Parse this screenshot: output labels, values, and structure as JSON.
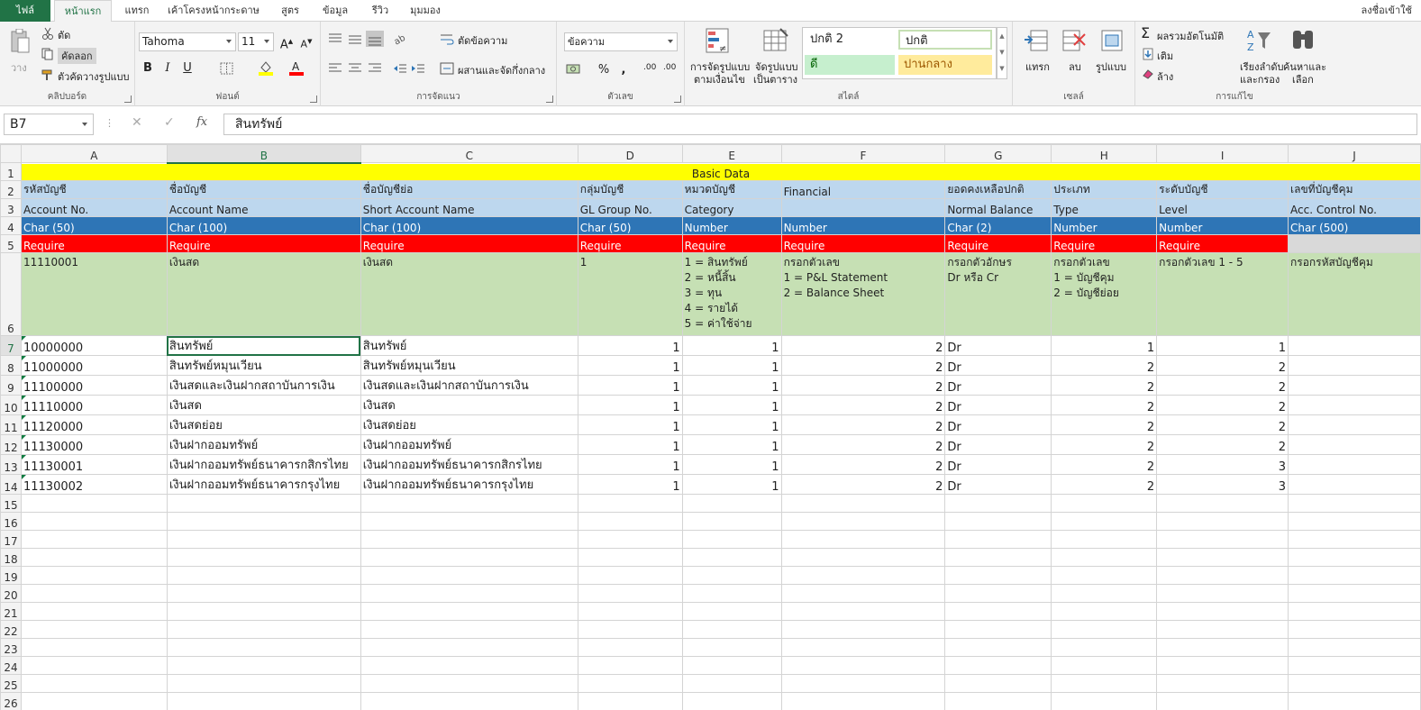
{
  "tabs": {
    "file": "ไฟล์",
    "home": "หน้าแรก",
    "insert": "แทรก",
    "page_layout": "เค้าโครงหน้ากระดาษ",
    "formulas": "สูตร",
    "data": "ข้อมูล",
    "review": "รีวิว",
    "view": "มุมมอง",
    "sign_in": "ลงชื่อเข้าใช้"
  },
  "ribbon": {
    "clipboard": {
      "label": "คลิปบอร์ด",
      "paste": "วาง",
      "cut": "ตัด",
      "copy": "คัดลอก",
      "format_painter": "ตัวคัดวางรูปแบบ"
    },
    "font": {
      "label": "ฟอนต์",
      "font_name": "Tahoma",
      "font_size": "11",
      "bold": "B",
      "italic": "I",
      "underline": "U"
    },
    "alignment": {
      "label": "การจัดแนว",
      "wrap_text": "ตัดข้อความ",
      "merge_center": "ผสานและจัดกึ่งกลาง"
    },
    "number": {
      "label": "ตัวเลข",
      "format": "ข้อความ",
      "percent": "%",
      "comma": ",",
      "inc_decimal": ".00",
      "dec_decimal": ".00"
    },
    "styles": {
      "label": "สไตล์",
      "conditional": "การจัดรูปแบบ",
      "conditional2": "ตามเงื่อนไข",
      "as_table": "จัดรูปแบบ",
      "as_table2": "เป็นตาราง",
      "normal2": "ปกติ 2",
      "normal": "ปกติ",
      "good": "ดี",
      "neutral": "ปานกลาง"
    },
    "cells": {
      "label": "เซลล์",
      "insert": "แทรก",
      "delete": "ลบ",
      "format": "รูปแบบ"
    },
    "editing": {
      "label": "การแก้ไข",
      "autosum": "ผลรวมอัตโนมัติ",
      "fill": "เติม",
      "clear": "ล้าง",
      "sort": "เรียงลำดับ",
      "sort2": "และกรอง",
      "find": "ค้นหาและ",
      "find2": "เลือก"
    }
  },
  "formula_bar": {
    "name_box": "B7",
    "fx": "fx",
    "content": "สินทรัพย์"
  },
  "columns": [
    "A",
    "B",
    "C",
    "D",
    "E",
    "F",
    "G",
    "H",
    "I",
    "J"
  ],
  "row_numbers": [
    "1",
    "2",
    "3",
    "4",
    "5",
    "6",
    "7",
    "8",
    "9",
    "10",
    "11",
    "12",
    "13",
    "14",
    "15",
    "16",
    "17",
    "18",
    "19",
    "20",
    "21",
    "22",
    "23",
    "24",
    "25",
    "26"
  ],
  "sheet": {
    "title": "Basic Data",
    "thai_headers": [
      "รหัสบัญชี",
      "ชื่อบัญชี",
      "ชื่อบัญชีย่อ",
      "กลุ่มบัญชี",
      "หมวดบัญชี",
      "Financial",
      "ยอดคงเหลือปกติ",
      "ประเภท",
      "ระดับบัญชี",
      "เลขที่บัญชีคุม"
    ],
    "eng_headers": [
      "Account No.",
      "Account Name",
      "Short Account Name",
      "GL Group No.",
      "Category",
      "",
      "Normal Balance",
      "Type",
      "Level",
      "Acc. Control No."
    ],
    "types": [
      "Char (50)",
      "Char (100)",
      "Char (100)",
      "Char (50)",
      "Number",
      "Number",
      "Char (2)",
      "Number",
      "Number",
      "Char (500)"
    ],
    "require": [
      "Require",
      "Require",
      "Require",
      "Require",
      "Require",
      "Require",
      "Require",
      "Require",
      "Require",
      ""
    ],
    "notes": {
      "a": "11110001",
      "b": "เงินสด",
      "c": "เงินสด",
      "d": "1",
      "e": [
        "1 = สินทรัพย์",
        "2 = หนี้สิ้น",
        "3 = ทุน",
        "4 = รายได้",
        "5 = ค่าใช้จ่าย"
      ],
      "f": [
        "กรอกตัวเลข",
        "1 = P&L Statement",
        "2 = Balance Sheet"
      ],
      "g": [
        "กรอกตัวอักษร",
        "Dr หรือ Cr"
      ],
      "h": [
        "กรอกตัวเลข",
        "1 = บัญชีคุม",
        "2 = บัญชีย่อย"
      ],
      "i": "กรอกตัวเลข 1 - 5",
      "j": "กรอกรหัสบัญชีคุม"
    },
    "rows": [
      {
        "no": "10000000",
        "name": "สินทรัพย์",
        "short": "สินทรัพย์",
        "group": "1",
        "cat": "1",
        "fin": "2",
        "bal": "Dr",
        "type": "1",
        "level": "1"
      },
      {
        "no": "11000000",
        "name": "สินทรัพย์หมุนเวียน",
        "short": "สินทรัพย์หมุนเวียน",
        "group": "1",
        "cat": "1",
        "fin": "2",
        "bal": "Dr",
        "type": "2",
        "level": "2"
      },
      {
        "no": "11100000",
        "name": "เงินสดและเงินฝากสถาบันการเงิน",
        "short": "เงินสดและเงินฝากสถาบันการเงิน",
        "group": "1",
        "cat": "1",
        "fin": "2",
        "bal": "Dr",
        "type": "2",
        "level": "2"
      },
      {
        "no": "11110000",
        "name": "เงินสด",
        "short": "เงินสด",
        "group": "1",
        "cat": "1",
        "fin": "2",
        "bal": "Dr",
        "type": "2",
        "level": "2"
      },
      {
        "no": "11120000",
        "name": "เงินสดย่อย",
        "short": "เงินสดย่อย",
        "group": "1",
        "cat": "1",
        "fin": "2",
        "bal": "Dr",
        "type": "2",
        "level": "2"
      },
      {
        "no": "11130000",
        "name": "เงินฝากออมทรัพย์",
        "short": "เงินฝากออมทรัพย์",
        "group": "1",
        "cat": "1",
        "fin": "2",
        "bal": "Dr",
        "type": "2",
        "level": "2"
      },
      {
        "no": "11130001",
        "name": "เงินฝากออมทรัพย์ธนาคารกสิกรไทย",
        "short": "เงินฝากออมทรัพย์ธนาคารกสิกรไทย",
        "group": "1",
        "cat": "1",
        "fin": "2",
        "bal": "Dr",
        "type": "2",
        "level": "3"
      },
      {
        "no": "11130002",
        "name": "เงินฝากออมทรัพย์ธนาคารกรุงไทย",
        "short": "เงินฝากออมทรัพย์ธนาคารกรุงไทย",
        "group": "1",
        "cat": "1",
        "fin": "2",
        "bal": "Dr",
        "type": "2",
        "level": "3"
      }
    ]
  }
}
